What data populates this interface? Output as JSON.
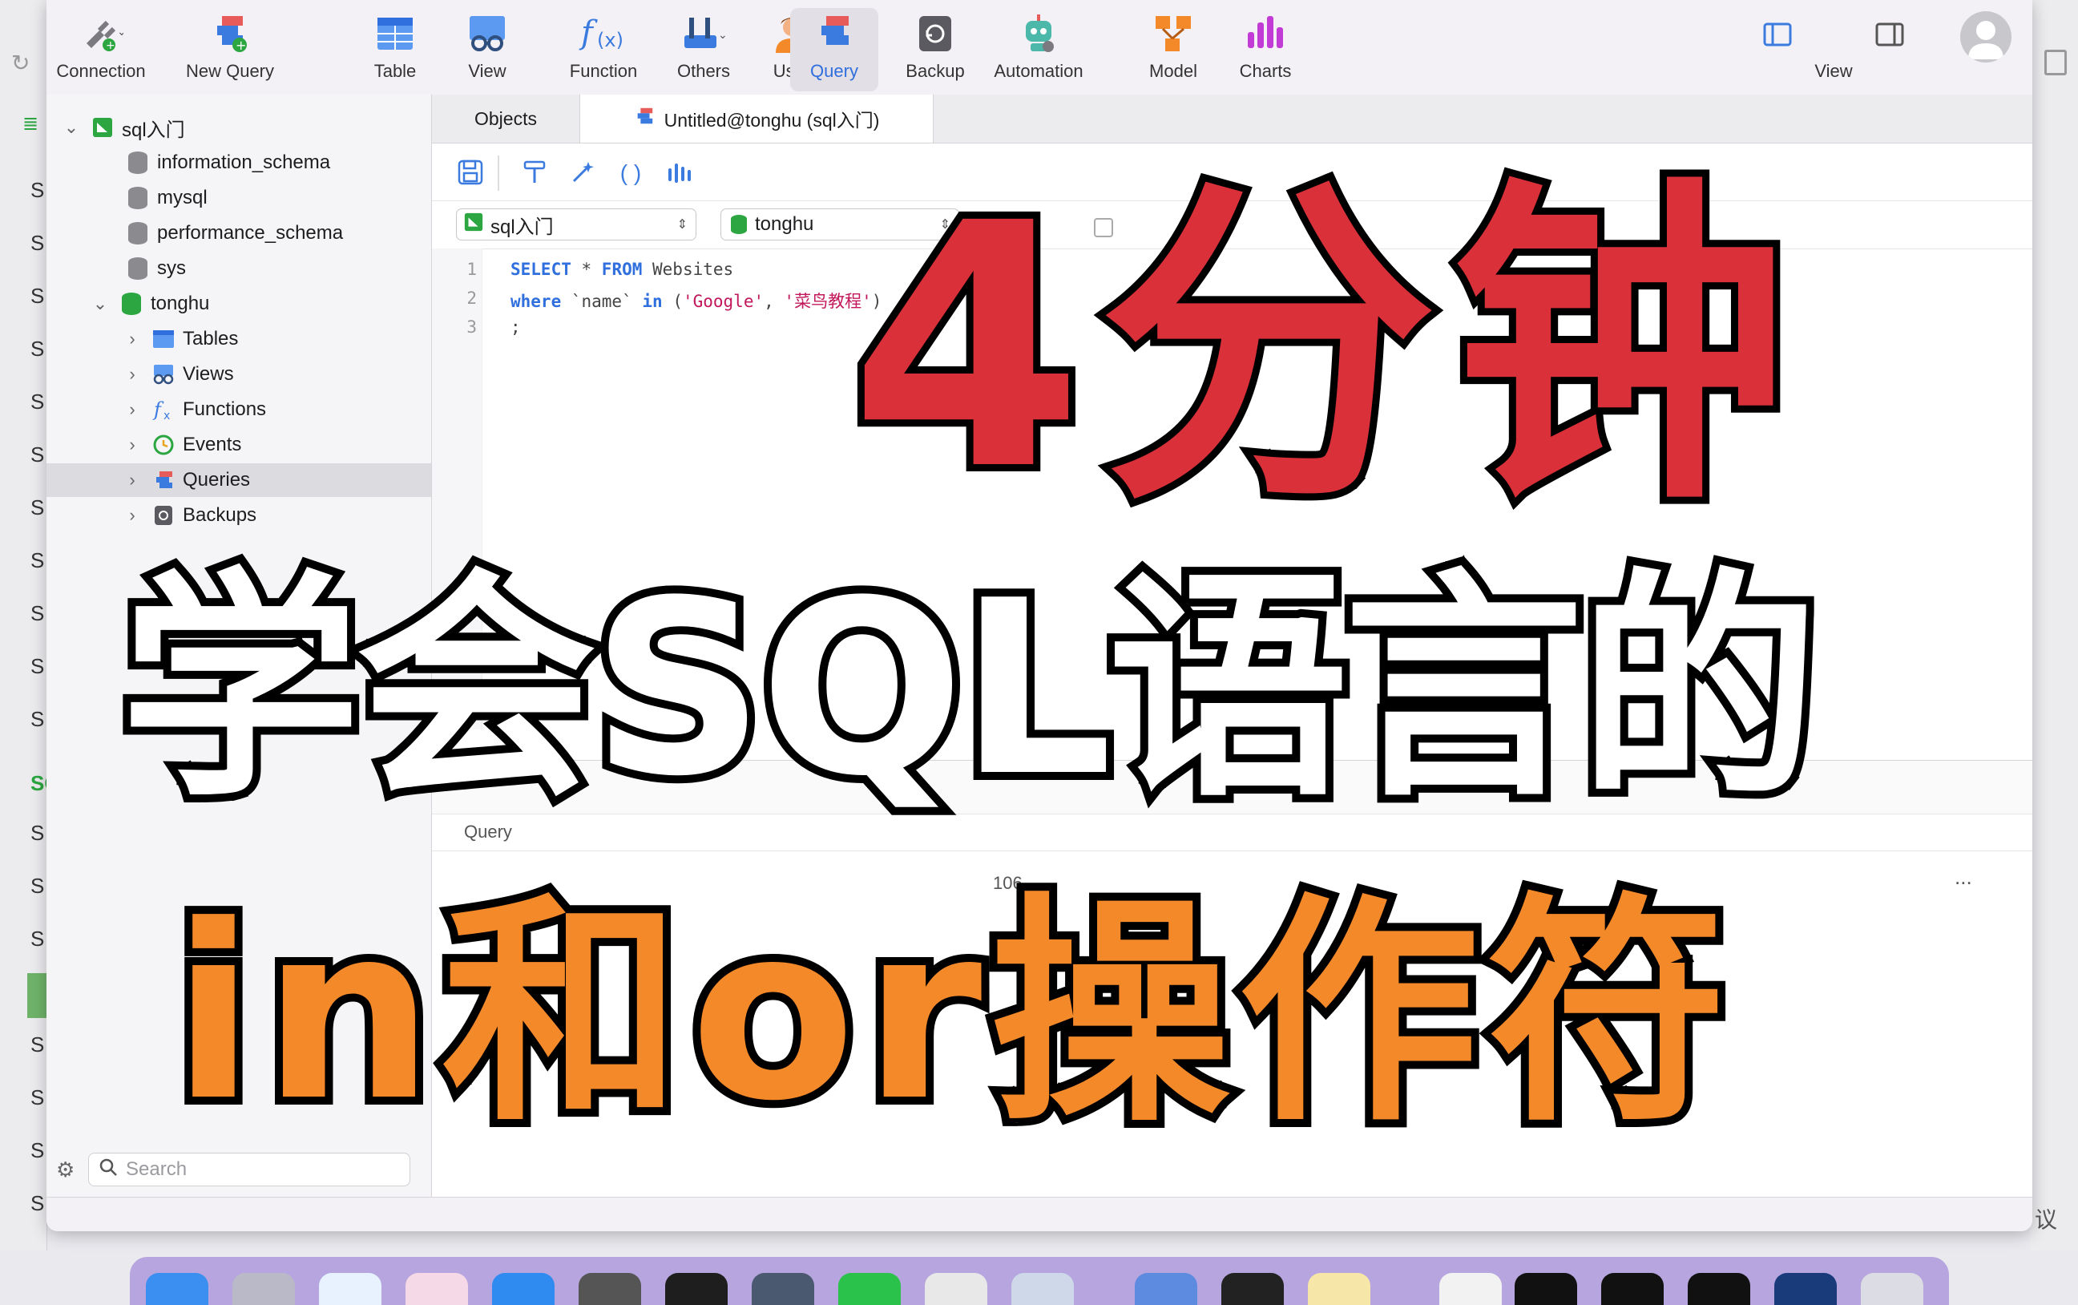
{
  "toolbar": {
    "items": [
      {
        "label": "Connection",
        "icon": "plug-icon"
      },
      {
        "label": "New Query",
        "icon": "new-query-icon"
      },
      {
        "label": "Table",
        "icon": "table-icon"
      },
      {
        "label": "View",
        "icon": "view-icon"
      },
      {
        "label": "Function",
        "icon": "function-icon"
      },
      {
        "label": "Others",
        "icon": "tools-icon"
      },
      {
        "label": "User",
        "icon": "user-icon"
      },
      {
        "label": "Query",
        "icon": "query-icon"
      },
      {
        "label": "Backup",
        "icon": "backup-icon"
      },
      {
        "label": "Automation",
        "icon": "robot-icon"
      },
      {
        "label": "Model",
        "icon": "model-icon"
      },
      {
        "label": "Charts",
        "icon": "charts-icon"
      }
    ],
    "view_label": "View",
    "active_item": "Query",
    "accent_color": "#2f6fde"
  },
  "sidebar": {
    "connection": "sql入门",
    "databases": [
      "information_schema",
      "mysql",
      "performance_schema",
      "sys",
      "tonghu"
    ],
    "tonghu_children": [
      "Tables",
      "Views",
      "Functions",
      "Events",
      "Queries",
      "Backups"
    ],
    "selected": "Queries",
    "search_placeholder": "Search"
  },
  "tabs": {
    "objects": "Objects",
    "query_tab": "Untitled@tonghu (sql入门)"
  },
  "selectors": {
    "connection": "sql入门",
    "database": "tonghu"
  },
  "editor": {
    "line_numbers": [
      "1",
      "2",
      "3"
    ],
    "line1_kw1": "SELECT",
    "line1_star": " * ",
    "line1_kw2": "FROM",
    "line1_rest": " Websites",
    "line2_kw1": "where",
    "line2_mid": " `name` ",
    "line2_kw2": "in",
    "line2_open": " (",
    "line2_str1": "'Google'",
    "line2_comma": ", ",
    "line2_str2": "'菜鸟教程'",
    "line2_close": ")",
    "line3": ";"
  },
  "results": {
    "col_query": "Query",
    "fragment_num": "106",
    "more": "..."
  },
  "background_list": [
    "S",
    "S",
    "S",
    "S",
    "S",
    "S",
    "S",
    "S",
    "S",
    "S",
    "S",
    "SQ",
    "S",
    "S",
    "S",
    "S",
    "S",
    "S",
    "S"
  ],
  "overlay": {
    "line1": "4分钟",
    "line2": "学会SQL语言的",
    "line3": "in和or操作符",
    "colors": {
      "line1": "#d9303a",
      "line2": "#ffffff",
      "line3": "#f4892a",
      "outline": "#000000"
    }
  },
  "right_edge_text": "议"
}
